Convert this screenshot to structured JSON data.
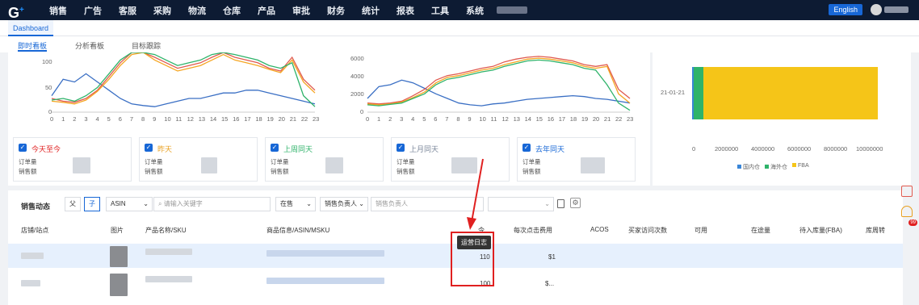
{
  "nav": {
    "logo": "G",
    "items": [
      "销售",
      "广告",
      "客服",
      "采购",
      "物流",
      "仓库",
      "产品",
      "审批",
      "财务",
      "统计",
      "报表",
      "工具",
      "系统"
    ],
    "lang": "English"
  },
  "tabs": {
    "dashboard": "Dashboard"
  },
  "subtabs": [
    "即时看板",
    "分析看板",
    "目标跟踪"
  ],
  "chart1": {
    "yticks": [
      "100",
      "50",
      "0"
    ],
    "xticks": [
      "0",
      "1",
      "2",
      "3",
      "4",
      "5",
      "6",
      "7",
      "8",
      "9",
      "10",
      "11",
      "12",
      "13",
      "14",
      "15",
      "16",
      "17",
      "18",
      "19",
      "20",
      "21",
      "22",
      "23"
    ]
  },
  "chart2": {
    "yticks": [
      "6000",
      "4000",
      "2000",
      "0"
    ]
  },
  "chart3": {
    "category": "21-01-21",
    "xticks": [
      "0",
      "2000000",
      "4000000",
      "6000000",
      "8000000",
      "10000000"
    ],
    "legend": [
      "国内仓",
      "海外仓",
      "FBA"
    ],
    "colors": [
      "#3a86d8",
      "#2fb36a",
      "#f5c518"
    ]
  },
  "chart_data": [
    {
      "type": "line",
      "x": [
        0,
        1,
        2,
        3,
        4,
        5,
        6,
        7,
        8,
        9,
        10,
        11,
        12,
        13,
        14,
        15,
        16,
        17,
        18,
        19,
        20,
        21,
        22,
        23
      ],
      "ylim": [
        0,
        100
      ],
      "series": [
        {
          "values": [
            30,
            60,
            55,
            70,
            55,
            40,
            25,
            15,
            12,
            10,
            15,
            20,
            25,
            25,
            30,
            35,
            35,
            40,
            40,
            35,
            30,
            25,
            20,
            15
          ]
        },
        {
          "values": [
            25,
            20,
            18,
            25,
            40,
            65,
            90,
            110,
            120,
            100,
            90,
            80,
            85,
            90,
            100,
            110,
            100,
            95,
            90,
            80,
            75,
            100,
            60,
            40
          ]
        },
        {
          "values": [
            20,
            18,
            15,
            22,
            38,
            60,
            85,
            105,
            115,
            95,
            85,
            75,
            80,
            85,
            95,
            105,
            95,
            90,
            85,
            78,
            72,
            95,
            55,
            35
          ]
        },
        {
          "values": [
            22,
            25,
            20,
            30,
            45,
            70,
            95,
            115,
            125,
            105,
            95,
            85,
            90,
            95,
            105,
            115,
            105,
            100,
            95,
            85,
            80,
            90,
            30,
            10
          ]
        }
      ]
    },
    {
      "type": "line",
      "x": [
        0,
        1,
        2,
        3,
        4,
        5,
        6,
        7,
        8,
        9,
        10,
        11,
        12,
        13,
        14,
        15,
        16,
        17,
        18,
        19,
        20,
        21,
        22,
        23
      ],
      "ylim": [
        0,
        6000
      ],
      "series": [
        {
          "values": [
            1500,
            2800,
            3000,
            3500,
            3200,
            2600,
            2000,
            1500,
            1000,
            800,
            700,
            900,
            1000,
            1200,
            1400,
            1500,
            1600,
            1700,
            1800,
            1700,
            1500,
            1400,
            1200,
            1000
          ]
        },
        {
          "values": [
            1000,
            900,
            1000,
            1200,
            1800,
            2500,
            3500,
            4000,
            4200,
            4500,
            4800,
            5000,
            5500,
            5800,
            6000,
            6100,
            6000,
            5800,
            5600,
            5200,
            5000,
            5200,
            2500,
            1500
          ]
        },
        {
          "values": [
            900,
            800,
            900,
            1100,
            1600,
            2200,
            3200,
            3800,
            4000,
            4300,
            4600,
            4800,
            5200,
            5500,
            5800,
            5900,
            5800,
            5600,
            5400,
            5000,
            4800,
            5000,
            2000,
            1000
          ]
        },
        {
          "values": [
            800,
            700,
            850,
            1000,
            1500,
            2000,
            3000,
            3600,
            3800,
            4100,
            4400,
            4600,
            5000,
            5300,
            5600,
            5700,
            5600,
            5400,
            5200,
            4800,
            4600,
            3000,
            1000,
            200
          ]
        }
      ]
    },
    {
      "type": "bar",
      "categories": [
        "21-01-21"
      ],
      "series": [
        {
          "name": "国内仓",
          "values": [
            100000
          ]
        },
        {
          "name": "海外仓",
          "values": [
            500000
          ]
        },
        {
          "name": "FBA",
          "values": [
            9000000
          ]
        }
      ],
      "xlim": [
        0,
        10000000
      ]
    }
  ],
  "compare": [
    {
      "title": "今天至今",
      "color": "#e02020",
      "r1": "订单量",
      "r2": "销售额"
    },
    {
      "title": "昨天",
      "color": "#e8a020",
      "r1": "订单量",
      "r2": "销售额"
    },
    {
      "title": "上周同天",
      "color": "#2fb36a",
      "r1": "订单量",
      "r2": "销售额"
    },
    {
      "title": "上月同天",
      "color": "#7a8699",
      "r1": "订单量",
      "r2": "销售额"
    },
    {
      "title": "去年同天",
      "color": "#1767d6",
      "r1": "订单量",
      "r2": "销售额"
    }
  ],
  "filters": {
    "title": "销售动态",
    "btn_parent": "父",
    "btn_child": "子",
    "asin": "ASIN",
    "keyword_ph": "请输入关键字",
    "status": "在售",
    "owner": "销售负责人",
    "owner_ph": "销售负责人"
  },
  "table": {
    "headers": [
      "店铺/站点",
      "图片",
      "产品名称/SKU",
      "商品信息/ASIN/MSKU",
      "令",
      "每次点击费用",
      "ACOS",
      "买家访问次数",
      "可用",
      "在途量",
      "待入库量(FBA)",
      "库周转"
    ],
    "row1": {
      "count": "110",
      "cpc": "$1"
    },
    "row2": {
      "count": "100",
      "cpc": "$..."
    }
  },
  "tooltip": "运营日志",
  "badge": "99"
}
